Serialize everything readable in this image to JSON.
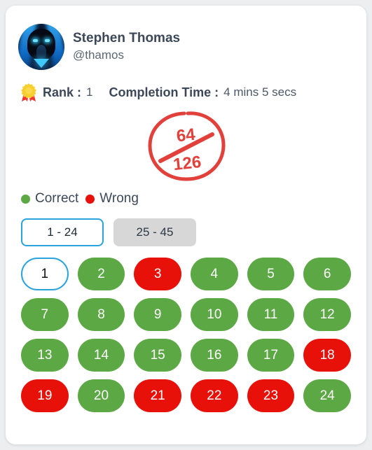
{
  "colors": {
    "correct": "#5ba845",
    "wrong": "#e8110a",
    "accent": "#29a3dc",
    "text": "#3c4858",
    "score_ring": "#e2403a",
    "page_bg": "#eceef0",
    "card_bg": "#ffffff",
    "tab_inactive_bg": "#d7d7d7"
  },
  "profile": {
    "avatar_icon": "hooded-figure-avatar",
    "display_name": "Stephen Thomas",
    "handle": "@thamos"
  },
  "stats": {
    "medal_icon": "award-ribbon-icon",
    "rank_label": "Rank :",
    "rank_value": "1",
    "time_label": "Completion Time :",
    "time_value": "4 mins 5 secs"
  },
  "score": {
    "numerator": "64",
    "denominator": "126"
  },
  "legend": [
    {
      "label": "Correct",
      "color": "#5ba845",
      "icon": "green-dot-icon"
    },
    {
      "label": "Wrong",
      "color": "#e8110a",
      "icon": "red-dot-icon"
    }
  ],
  "tabs": [
    {
      "label": "1 - 24",
      "active": true
    },
    {
      "label": "25 - 45",
      "active": false
    }
  ],
  "questions": [
    {
      "n": "1",
      "state": "current"
    },
    {
      "n": "2",
      "state": "correct"
    },
    {
      "n": "3",
      "state": "wrong"
    },
    {
      "n": "4",
      "state": "correct"
    },
    {
      "n": "5",
      "state": "correct"
    },
    {
      "n": "6",
      "state": "correct"
    },
    {
      "n": "7",
      "state": "correct"
    },
    {
      "n": "8",
      "state": "correct"
    },
    {
      "n": "9",
      "state": "correct"
    },
    {
      "n": "10",
      "state": "correct"
    },
    {
      "n": "11",
      "state": "correct"
    },
    {
      "n": "12",
      "state": "correct"
    },
    {
      "n": "13",
      "state": "correct"
    },
    {
      "n": "14",
      "state": "correct"
    },
    {
      "n": "15",
      "state": "correct"
    },
    {
      "n": "16",
      "state": "correct"
    },
    {
      "n": "17",
      "state": "correct"
    },
    {
      "n": "18",
      "state": "wrong"
    },
    {
      "n": "19",
      "state": "wrong"
    },
    {
      "n": "20",
      "state": "correct"
    },
    {
      "n": "21",
      "state": "wrong"
    },
    {
      "n": "22",
      "state": "wrong"
    },
    {
      "n": "23",
      "state": "wrong"
    },
    {
      "n": "24",
      "state": "correct"
    }
  ]
}
